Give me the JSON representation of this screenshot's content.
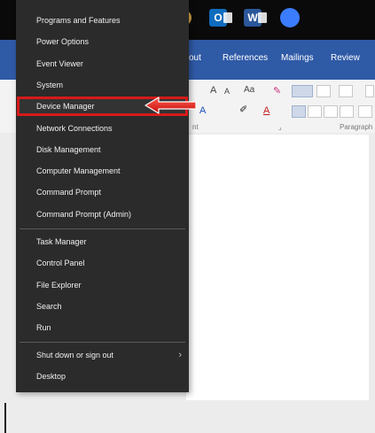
{
  "ribbon": {
    "tabs": [
      "out",
      "References",
      "Mailings",
      "Review"
    ],
    "group_labels": [
      "nt",
      "Paragraph"
    ],
    "font_size_glyphs": [
      "A",
      "A"
    ],
    "change_case_glyph": "Aa"
  },
  "menu": {
    "items_group1": [
      "Programs and Features",
      "Power Options",
      "Event Viewer",
      "System",
      "Device Manager",
      "Network Connections",
      "Disk Management",
      "Computer Management",
      "Command Prompt",
      "Command Prompt (Admin)"
    ],
    "items_group2": [
      "Task Manager",
      "Control Panel",
      "File Explorer",
      "Search",
      "Run"
    ],
    "items_group3": [
      "Shut down or sign out",
      "Desktop"
    ],
    "highlighted_item": "Device Manager",
    "submenu_chevron": "›"
  },
  "taskbar": {
    "icons": [
      "outlook-icon",
      "word-icon",
      "teams-icon"
    ],
    "word_letter": "W"
  },
  "colors": {
    "menu_bg": "#2b2b2b",
    "ribbon_blue": "#2f5aa6",
    "highlight_red": "#d51a1a",
    "taskbar_bg": "#0a0a0a"
  }
}
